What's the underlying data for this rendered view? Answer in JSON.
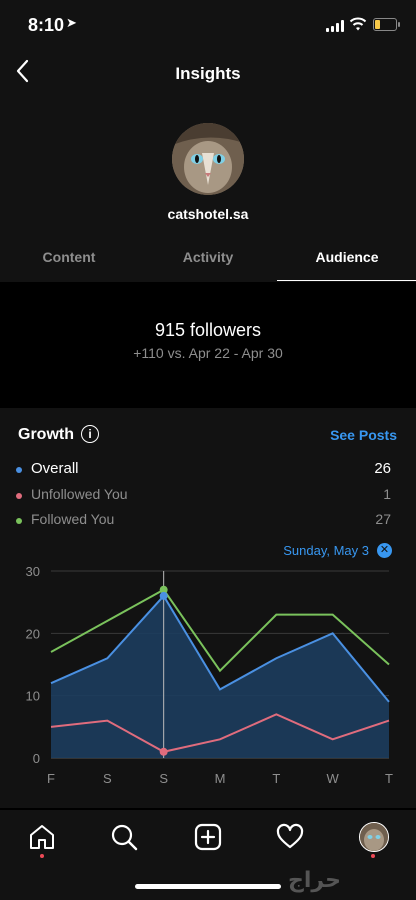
{
  "status_bar": {
    "time": "8:10"
  },
  "header": {
    "title": "Insights",
    "username": "catshotel.sa"
  },
  "tabs": [
    {
      "label": "Content",
      "active": false
    },
    {
      "label": "Activity",
      "active": false
    },
    {
      "label": "Audience",
      "active": true
    }
  ],
  "followers": {
    "count_text": "915 followers",
    "change_text": "+110 vs. Apr 22 - Apr 30"
  },
  "growth": {
    "title": "Growth",
    "see_posts": "See Posts",
    "legend": [
      {
        "label": "Overall",
        "value": "26",
        "color": "#4a90e2"
      },
      {
        "label": "Unfollowed You",
        "value": "1",
        "color": "#e06c7d"
      },
      {
        "label": "Followed You",
        "value": "27",
        "color": "#7ac25c"
      }
    ],
    "tooltip_date": "Sunday, May 3",
    "colors": {
      "overall": "#4a90e2",
      "unfollowed": "#e06c7d",
      "followed": "#7ac25c",
      "fill": "#1d3d5e"
    }
  },
  "chart_data": {
    "type": "line",
    "categories": [
      "F",
      "S",
      "S",
      "M",
      "T",
      "W",
      "T"
    ],
    "series": [
      {
        "name": "Overall",
        "values": [
          12,
          16,
          26,
          11,
          16,
          20,
          9
        ]
      },
      {
        "name": "Unfollowed You",
        "values": [
          5,
          6,
          1,
          3,
          7,
          3,
          6
        ]
      },
      {
        "name": "Followed You",
        "values": [
          17,
          22,
          27,
          14,
          23,
          23,
          15
        ]
      }
    ],
    "yticks": [
      "0",
      "10",
      "20",
      "30"
    ],
    "ylim": [
      0,
      30
    ],
    "highlight_index": 2,
    "grid": true
  },
  "bottom_nav": [
    {
      "icon": "home-icon"
    },
    {
      "icon": "search-icon"
    },
    {
      "icon": "add-post-icon"
    },
    {
      "icon": "heart-icon"
    },
    {
      "icon": "profile-icon"
    }
  ],
  "watermark": "حراج"
}
